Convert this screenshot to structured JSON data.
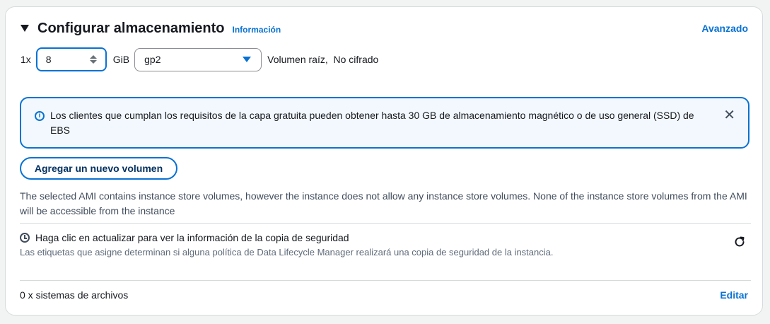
{
  "section": {
    "title": "Configurar almacenamiento",
    "info_link": "Información",
    "advanced_link": "Avanzado"
  },
  "volume": {
    "quantity_prefix": "1x",
    "size_value": "8",
    "size_unit": "GiB",
    "volume_type": "gp2",
    "description": "Volumen raíz,  No cifrado"
  },
  "alert": {
    "text": "Los clientes que cumplan los requisitos de la capa gratuita pueden obtener hasta 30 GB de almacenamiento magnético o de uso general (SSD) de EBS",
    "icon": "info-icon",
    "close_icon": "close-icon"
  },
  "add_volume_button": "Agregar un nuevo volumen",
  "ami_note": "The selected AMI contains instance store volumes, however the instance does not allow any instance store volumes. None of the instance store volumes from the AMI will be accessible from the instance",
  "backup": {
    "title": "Haga clic en actualizar para ver la información de la copia de seguridad",
    "description": "Las etiquetas que asigne determinan si alguna política de Data Lifecycle Manager realizará una copia de seguridad de la instancia.",
    "icon": "clock-icon",
    "refresh_icon": "refresh-icon"
  },
  "file_systems": {
    "label": "0 x sistemas de archivos",
    "edit_link": "Editar"
  },
  "colors": {
    "accent": "#0972d3",
    "alert_bg": "#f2f8fd",
    "border": "#d5dbdb"
  }
}
